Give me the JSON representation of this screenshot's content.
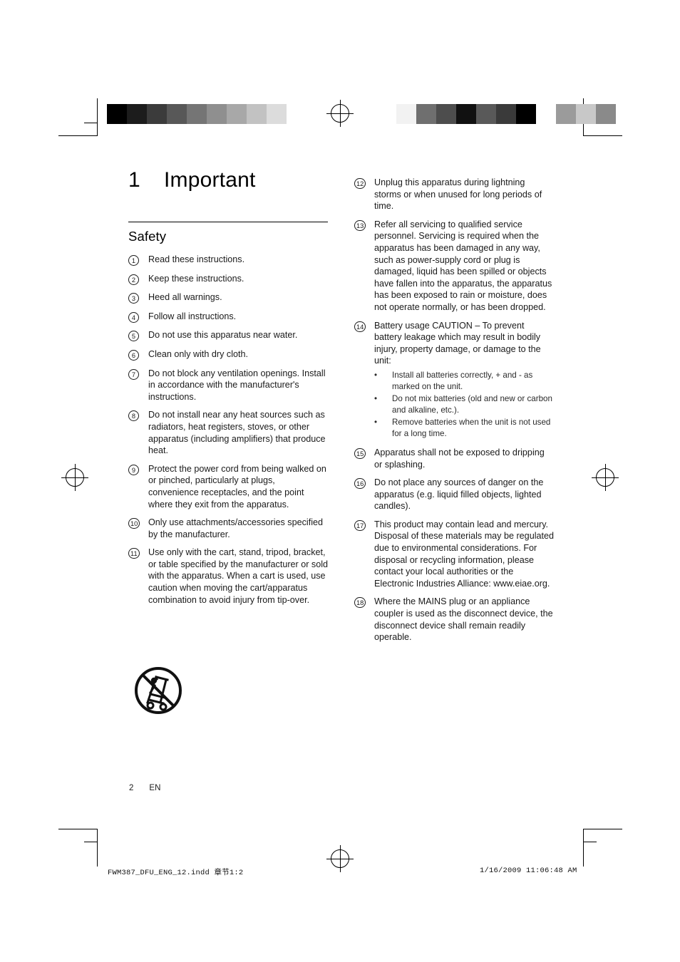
{
  "document": {
    "chapter_number": "1",
    "chapter_title": "Important",
    "section_title": "Safety",
    "page_number": "2",
    "language_code": "EN",
    "footer_left": "FWM387_DFU_ENG_12.indd   章节1:2",
    "footer_right": "1/16/2009   11:06:48 AM"
  },
  "colors": {
    "text": "#1a1a1a",
    "rule": "#000000"
  },
  "safety_items_left": [
    {
      "num": "1",
      "text": "Read these instructions."
    },
    {
      "num": "2",
      "text": "Keep these instructions."
    },
    {
      "num": "3",
      "text": "Heed all warnings."
    },
    {
      "num": "4",
      "text": "Follow all instructions."
    },
    {
      "num": "5",
      "text": "Do not use this apparatus near water."
    },
    {
      "num": "6",
      "text": "Clean only with dry cloth."
    },
    {
      "num": "7",
      "text": "Do not block any ventilation openings. Install in accordance with the manufacturer's instructions."
    },
    {
      "num": "8",
      "text": "Do not install near any heat sources such as radiators, heat registers, stoves, or other apparatus (including amplifiers) that produce heat."
    },
    {
      "num": "9",
      "text": "Protect the power cord from being walked on or pinched, particularly at plugs, convenience receptacles, and the point where they exit from the apparatus."
    },
    {
      "num": "10",
      "text": "Only use attachments/accessories specified by the manufacturer."
    },
    {
      "num": "11",
      "text": "Use only with the cart, stand, tripod, bracket, or table specified by the manufacturer or sold with the apparatus. When a cart is used, use caution when moving the cart/apparatus combination to avoid injury from tip-over."
    }
  ],
  "safety_items_right": [
    {
      "num": "12",
      "text": "Unplug this apparatus during lightning storms or when unused for long periods of time."
    },
    {
      "num": "13",
      "text": "Refer all servicing to qualified service personnel. Servicing is required when the apparatus has been damaged in any way, such as power-supply cord or plug is damaged, liquid has been spilled or objects have fallen into the apparatus, the apparatus has been exposed to rain or moisture, does not operate normally, or has been dropped."
    },
    {
      "num": "14",
      "text": "Battery usage CAUTION – To prevent battery leakage which may result in bodily injury, property damage, or damage to the unit:",
      "subitems": [
        "Install all batteries correctly, + and - as marked on the unit.",
        "Do not mix batteries (old and new or carbon and alkaline, etc.).",
        "Remove batteries when the unit is not used for a long time."
      ]
    },
    {
      "num": "15",
      "text": "Apparatus shall not be exposed to dripping or splashing."
    },
    {
      "num": "16",
      "text": "Do not place any sources of danger on the apparatus (e.g. liquid filled objects, lighted candles)."
    },
    {
      "num": "17",
      "text": "This product may contain lead and mercury. Disposal of these materials may be regulated due to environmental considerations. For disposal or recycling information, please contact your local authorities or the Electronic Industries Alliance: www.eiae.org."
    },
    {
      "num": "18",
      "text": "Where the MAINS plug or an appliance coupler is used as the disconnect device, the disconnect device shall remain readily operable."
    }
  ],
  "color_bars": {
    "left": [
      "#000000",
      "#1c1c1c",
      "#3b3b3b",
      "#585858",
      "#757575",
      "#8f8f8f",
      "#a8a8a8",
      "#c2c2c2",
      "#dcdcdc",
      "#ffffff"
    ],
    "right": [
      "#f2f2f2",
      "#6f6f6f",
      "#4d4d4d",
      "#111111",
      "#595959",
      "#3a3a3a",
      "#000000",
      "#ffffff",
      "#9b9b9b",
      "#c8c8c8",
      "#8a8a8a"
    ]
  },
  "bullet_glyph": "•"
}
